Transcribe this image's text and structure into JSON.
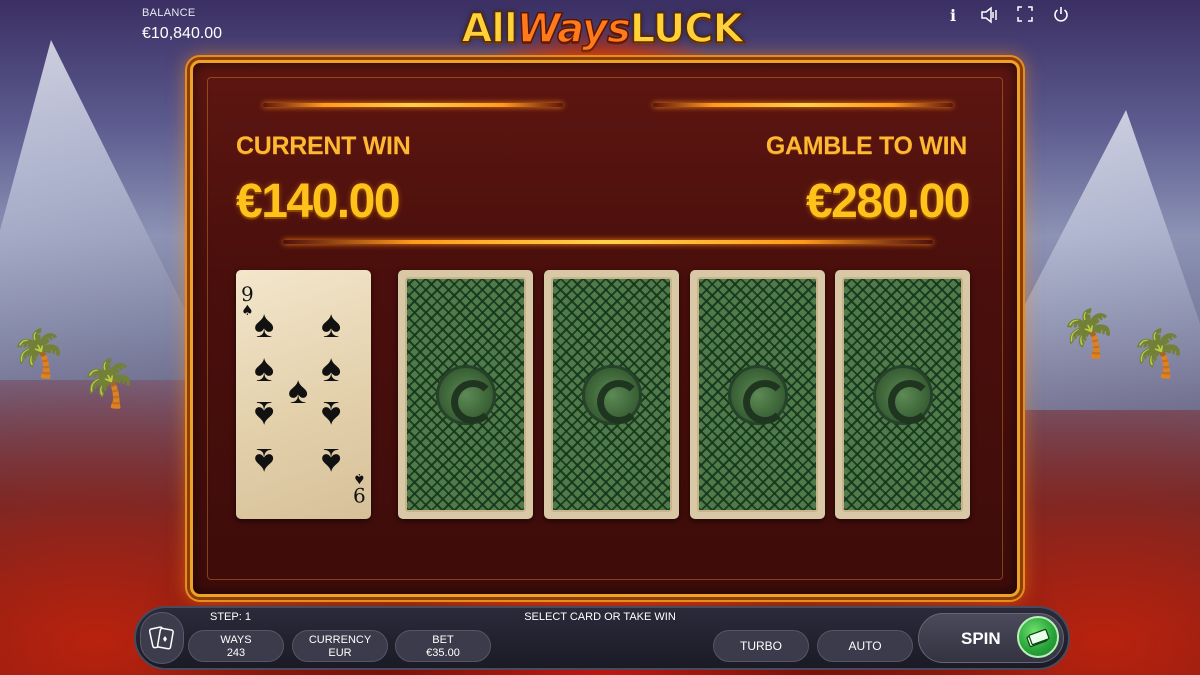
{
  "header": {
    "balance_label": "BALANCE",
    "balance_value": "€10,840.00",
    "logo_part1": "All",
    "logo_part2": "Ways",
    "logo_part3": "LUCK",
    "icons": [
      "info-icon",
      "sound-icon",
      "fullscreen-icon",
      "power-icon"
    ]
  },
  "gamble": {
    "current_win_label": "CURRENT WIN",
    "current_win_value": "€140.00",
    "gamble_label": "GAMBLE TO WIN",
    "gamble_value": "€280.00",
    "revealed_card": {
      "rank": "9",
      "suit": "♠"
    },
    "hidden_cards": 4
  },
  "bottom": {
    "step_label": "STEP: 1",
    "status_text": "SELECT CARD OR TAKE WIN",
    "ways_label": "WAYS",
    "ways_value": "243",
    "currency_label": "CURRENCY",
    "currency_value": "EUR",
    "bet_label": "BET",
    "bet_value": "€35.00",
    "turbo_label": "TURBO",
    "auto_label": "AUTO",
    "spin_label": "SPIN"
  },
  "colors": {
    "accent_gold": "#ffc21a",
    "panel_border": "#f0a128",
    "spin_green": "#2aa63a"
  }
}
